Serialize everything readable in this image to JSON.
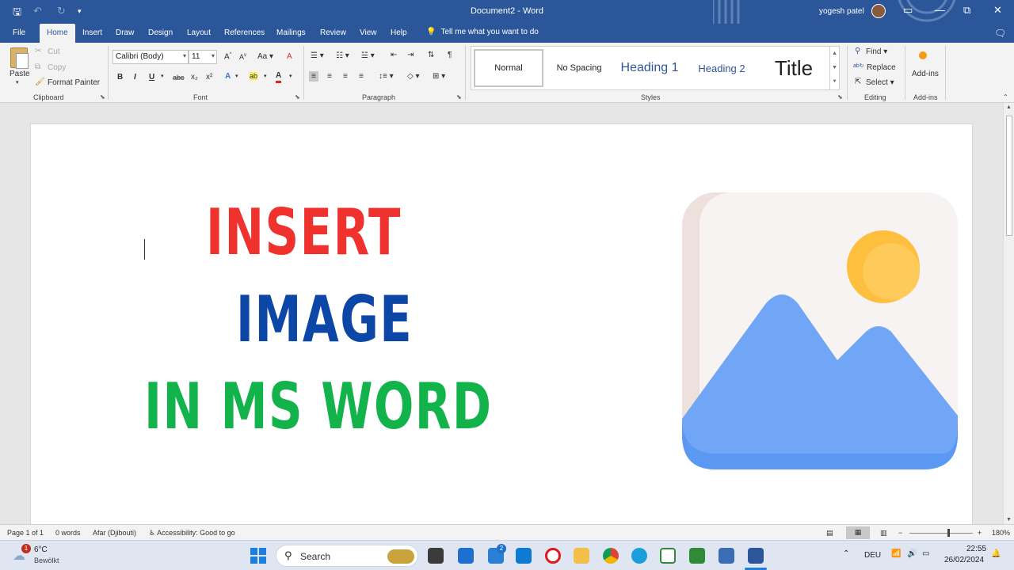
{
  "app": {
    "title": "Document2  -  Word",
    "user": "yogesh patel",
    "qat": {
      "save": "🖫",
      "undo": "↶",
      "redo": "↻",
      "customize": "▾"
    },
    "window_controls": {
      "ribbon_display": "▭",
      "minimize": "—",
      "restore": "⧉",
      "close": "✕"
    }
  },
  "menu": {
    "tabs": [
      "File",
      "Home",
      "Insert",
      "Draw",
      "Design",
      "Layout",
      "References",
      "Mailings",
      "Review",
      "View",
      "Help"
    ],
    "active": "Home",
    "tell_me": "Tell me what you want to do"
  },
  "ribbon": {
    "clipboard": {
      "paste": "Paste",
      "cut": "Cut",
      "copy": "Copy",
      "format_painter": "Format Painter",
      "label": "Clipboard"
    },
    "font": {
      "name": "Calibri (Body)",
      "size": "11",
      "grow": "A",
      "shrink": "A",
      "change_case": "Aa",
      "clear": "A",
      "bold": "B",
      "italic": "I",
      "underline": "U",
      "strike": "abc",
      "subscript": "x₂",
      "superscript": "x²",
      "effects": "A",
      "highlight": "ab",
      "color": "A",
      "label": "Font"
    },
    "paragraph": {
      "label": "Paragraph",
      "show_marks": "¶"
    },
    "styles": {
      "items": [
        "Normal",
        "No Spacing",
        "Heading 1",
        "Heading 2",
        "Title"
      ],
      "label": "Styles"
    },
    "editing": {
      "find": "Find",
      "replace": "Replace",
      "select": "Select",
      "label": "Editing"
    },
    "addins": {
      "button": "Add-ins",
      "label": "Add-ins"
    }
  },
  "document": {
    "lines": [
      "INSERT",
      "IMAGE",
      "IN MS WORD"
    ],
    "colors": {
      "line1": "#f0322f",
      "line2": "#0c47a8",
      "line3": "#11b34a"
    },
    "picture_icon": "image-placeholder-icon"
  },
  "status": {
    "page": "Page 1 of 1",
    "words": "0 words",
    "language": "Afar (Djibouti)",
    "accessibility": "Accessibility: Good to go",
    "zoom": "180%",
    "zoom_minus": "−",
    "zoom_plus": "+"
  },
  "taskbar": {
    "weather_temp": "6°C",
    "weather_desc": "Bewölkt",
    "weather_badge": "1",
    "search": "Search",
    "mail_badge": "2",
    "language": "DEU",
    "time": "22:55",
    "date": "26/02/2024"
  }
}
